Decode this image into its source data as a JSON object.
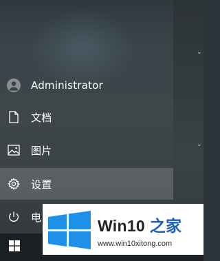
{
  "start_menu": {
    "items": [
      {
        "label": "Administrator",
        "icon": "user-avatar-icon"
      },
      {
        "label": "文档",
        "icon": "document-icon"
      },
      {
        "label": "图片",
        "icon": "picture-icon"
      },
      {
        "label": "设置",
        "icon": "gear-icon"
      },
      {
        "label": "电",
        "icon": "power-icon"
      }
    ],
    "active_item": "设置"
  },
  "taskbar": {
    "start_icon": "windows-logo-icon"
  },
  "watermark": {
    "title_main": "Win10 ",
    "title_accent": "之家",
    "url": "www.win10xitong.com",
    "logo_color": "#1e90e8"
  },
  "colors": {
    "menu_bg": "#3b4245",
    "active_bg": "#5a6164",
    "text": "#ffffff",
    "taskbar_bg": "#1c2023"
  }
}
